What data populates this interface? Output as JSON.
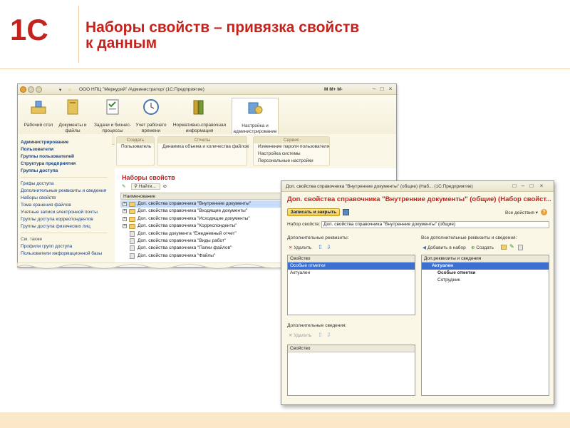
{
  "slide": {
    "logo_text": "1С",
    "title_line1": "Наборы свойств – привязка свойств",
    "title_line2": "к данным"
  },
  "main_window": {
    "title": "ООО НПЦ \"Меркурий\" /Администратор/  (1С:Предприятие)",
    "titlebar_right": "M  M+ M-",
    "sections": [
      {
        "label": "Рабочий стол"
      },
      {
        "label": "Документы и файлы"
      },
      {
        "label": "Задачи и бизнес-процессы"
      },
      {
        "label": "Учет рабочего времени"
      },
      {
        "label": "Нормативно-справочная информация"
      },
      {
        "label": "Настройка и администрирование"
      }
    ],
    "nav": {
      "primary": [
        "Администрирование",
        "Пользователи",
        "Группы пользователей",
        "Структура предприятия",
        "Группы доступа"
      ],
      "secondary": [
        "Грифы доступа",
        "Дополнительные реквизиты и сведения",
        "Наборы свойств",
        "Тома хранения файлов",
        "Учетные записи электронной почты",
        "Группы доступа корреспондентов",
        "Группы доступа физических лиц"
      ],
      "see_also_label": "См. также",
      "see_also": [
        "Профили групп доступа",
        "Пользователи информационной базы"
      ]
    },
    "groups": {
      "create": {
        "header": "Создать",
        "items": [
          "Пользователь"
        ]
      },
      "reports": {
        "header": "Отчеты",
        "items": [
          "Динамика объема и количества файлов"
        ]
      },
      "service": {
        "header": "Сервис",
        "items": [
          "Изменение пароля пользователя",
          "Настройка системы",
          "Персональные настройки"
        ]
      }
    },
    "list": {
      "title": "Наборы свойств",
      "find_label": "Найти...",
      "column": "Наименование",
      "rows": [
        {
          "text": "Доп. свойства справочника \"Внутренние документы\"",
          "kind": "folder",
          "selected": true
        },
        {
          "text": "Доп. свойства справочника \"Входящие документы\"",
          "kind": "folder"
        },
        {
          "text": "Доп. свойства справочника \"Исходящие документы\"",
          "kind": "folder"
        },
        {
          "text": "Доп. свойства справочника \"Корреспонденты\"",
          "kind": "folder"
        },
        {
          "text": "Доп. свойства документа \"Ежедневный отчет\"",
          "kind": "doc"
        },
        {
          "text": "Доп. свойства справочника \"Виды работ\"",
          "kind": "doc"
        },
        {
          "text": "Доп. свойства справочника \"Папки файлов\"",
          "kind": "doc"
        },
        {
          "text": "Доп. свойства справочника \"Файлы\"",
          "kind": "doc"
        }
      ]
    }
  },
  "dialog": {
    "window_title": "Доп. свойства справочника \"Внутренние документы\" (общие) (Наб...  (1С:Предприятие)",
    "title": "Доп. свойства справочника \"Внутренние документы\" (общие) (Набор свойст...",
    "save_close": "Записать и закрыть",
    "all_actions": "Все действия ▾",
    "set_label": "Набор свойств:",
    "set_value": "Доп. свойства справочника \"Внутренние документы\" (общие)",
    "left": {
      "requisites_label": "Дополнительные реквизиты:",
      "delete_label": "Удалить",
      "col": "Свойство",
      "rows": [
        {
          "text": "Особые отметки",
          "selected": true
        },
        {
          "text": "Актуален"
        }
      ],
      "info_label": "Дополнительные сведения:",
      "delete2_label": "Удалить",
      "col2": "Свойство"
    },
    "right": {
      "label": "Все дополнительные реквизиты и сведения:",
      "add_label": "Добавить в набор",
      "create_label": "Создать",
      "col": "Доп.реквизиты и сведения",
      "rows": [
        {
          "text": "Актуален",
          "selected": true,
          "bold": true
        },
        {
          "text": "Особые отметки",
          "bold": true
        },
        {
          "text": "Сотрудник"
        }
      ]
    }
  },
  "colors": {
    "brand_red": "#c4221c",
    "selection": "#3b6fd0",
    "accent_yellow": "#f1c94a"
  }
}
